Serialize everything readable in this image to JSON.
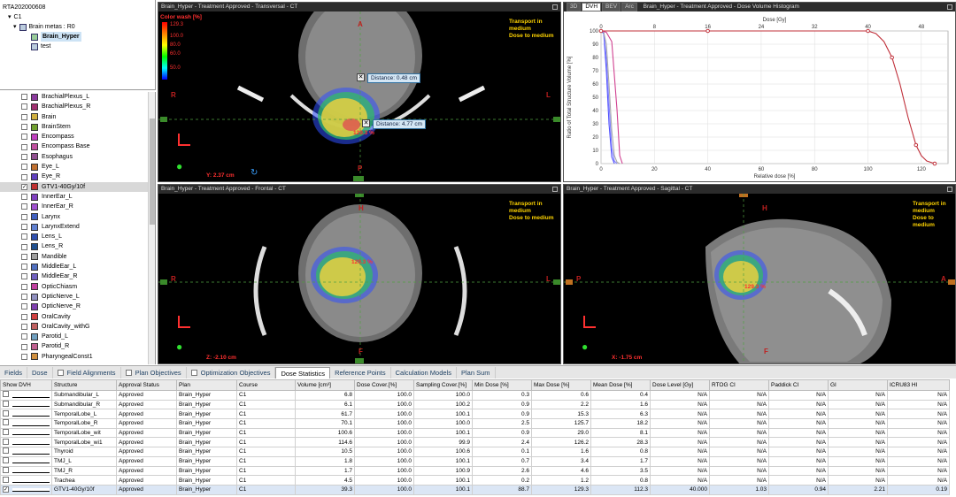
{
  "tree": {
    "root": "RTA202000608",
    "course": "C1",
    "metas": "Brain metas : R0",
    "plan": "Brain_Hyper",
    "test": "test"
  },
  "structures": [
    {
      "name": "BrachialPlexus_L",
      "color": "#8b3a9c",
      "checked": false
    },
    {
      "name": "BrachialPlexus_R",
      "color": "#a03070",
      "checked": false
    },
    {
      "name": "Brain",
      "color": "#d0b040",
      "checked": false
    },
    {
      "name": "BrainStem",
      "color": "#70a030",
      "checked": false
    },
    {
      "name": "Encompass",
      "color": "#c040c0",
      "checked": false
    },
    {
      "name": "Encompass Base",
      "color": "#c050a0",
      "checked": false
    },
    {
      "name": "Esophagus",
      "color": "#905090",
      "checked": false
    },
    {
      "name": "Eye_L",
      "color": "#c07030",
      "checked": false
    },
    {
      "name": "Eye_R",
      "color": "#6040c0",
      "checked": false
    },
    {
      "name": "GTV1-40Gy/10f",
      "color": "#c03030",
      "checked": true,
      "selected": true
    },
    {
      "name": "InnerEar_L",
      "color": "#8040c0",
      "checked": false
    },
    {
      "name": "InnerEar_R",
      "color": "#a050d0",
      "checked": false
    },
    {
      "name": "Larynx",
      "color": "#4060c0",
      "checked": false
    },
    {
      "name": "LarynxExtend",
      "color": "#6080d0",
      "checked": false
    },
    {
      "name": "Lens_L",
      "color": "#3050b0",
      "checked": false
    },
    {
      "name": "Lens_R",
      "color": "#205090",
      "checked": false
    },
    {
      "name": "Mandible",
      "color": "#a0a0a0",
      "checked": false
    },
    {
      "name": "MiddleEar_L",
      "color": "#5070c0",
      "checked": false
    },
    {
      "name": "MiddleEar_R",
      "color": "#7060c0",
      "checked": false
    },
    {
      "name": "OpticChiasm",
      "color": "#c040a0",
      "checked": false
    },
    {
      "name": "OpticNerve_L",
      "color": "#9090c0",
      "checked": false
    },
    {
      "name": "OpticNerve_R",
      "color": "#8040b0",
      "checked": false
    },
    {
      "name": "OralCavity",
      "color": "#d04040",
      "checked": false
    },
    {
      "name": "OralCavity_withG",
      "color": "#c06060",
      "checked": false
    },
    {
      "name": "Parotid_L",
      "color": "#70a0c0",
      "checked": false
    },
    {
      "name": "Parotid_R",
      "color": "#c06090",
      "checked": false
    },
    {
      "name": "PharyngealConst1",
      "color": "#d09040",
      "checked": false
    }
  ],
  "views": {
    "transversal": {
      "title": "Brain_Hyper - Treatment Approved - Transversal - CT",
      "coord": "Y: 2.37 cm",
      "legend_title": "Color wash [%]",
      "legend_max": "129.3",
      "legend_vals": [
        "100.0",
        "80.0",
        "60.0",
        "50.0"
      ],
      "dist1": "Distance: 0.48 cm",
      "dist2": "Distance: 4.77 cm",
      "hotspot": "129.3 %",
      "orient": {
        "top": "A",
        "left": "R",
        "right": "L",
        "bottom": "P"
      }
    },
    "frontal": {
      "title": "Brain_Hyper - Treatment Approved - Frontal - CT",
      "coord": "Z: -2.10 cm",
      "hotspot": "129.3 %",
      "orient": {
        "top": "H",
        "left": "R",
        "right": "L",
        "bottom": "F"
      }
    },
    "sagittal": {
      "title": "Brain_Hyper - Treatment Approved - Sagittal - CT",
      "coord": "X: -1.75 cm",
      "hotspot": "129.3 %",
      "orient": {
        "top": "H",
        "left": "P",
        "right": "A",
        "bottom": "F"
      }
    },
    "transport_line1": "Transport in",
    "transport_line2": "medium",
    "transport_line3": "Dose to medium"
  },
  "dvh": {
    "tabs": [
      "3D",
      "DVH",
      "BEV",
      "Arc"
    ],
    "active_tab": "DVH",
    "title": "Brain_Hyper - Treatment Approved - Dose Volume Histogram"
  },
  "chart_data": {
    "type": "line",
    "title": "Dose [Gy]",
    "xlabel": "Relative dose [%]",
    "ylabel": "Ratio of Total Structure Volume [%]",
    "xlim": [
      0,
      130
    ],
    "ylim": [
      0,
      100
    ],
    "x_ticks": [
      0,
      20,
      40,
      60,
      80,
      100,
      120
    ],
    "y_ticks": [
      0,
      10,
      20,
      30,
      40,
      50,
      60,
      70,
      80,
      90,
      100
    ],
    "top_ticks": [
      0,
      8,
      16,
      24,
      32,
      40,
      48
    ],
    "series": [
      {
        "color": "#c0303a",
        "x": [
          0,
          1,
          20,
          40,
          60,
          80,
          100,
          103,
          106,
          109,
          112,
          115,
          118,
          120,
          122,
          125
        ],
        "y": [
          100,
          100,
          100,
          100,
          100,
          100,
          100,
          98,
          92,
          80,
          60,
          35,
          14,
          6,
          2,
          0
        ]
      },
      {
        "color": "#5050ff",
        "x": [
          0,
          1,
          2,
          3,
          4,
          5
        ],
        "y": [
          100,
          98,
          70,
          30,
          5,
          0
        ]
      },
      {
        "color": "#8080ff",
        "x": [
          0,
          1,
          2,
          3,
          4,
          5,
          6
        ],
        "y": [
          100,
          99,
          80,
          45,
          12,
          2,
          0
        ]
      },
      {
        "color": "#ffffff",
        "x": [
          0,
          1,
          2,
          3,
          4,
          5,
          6,
          7
        ],
        "y": [
          100,
          99,
          90,
          60,
          25,
          6,
          1,
          0
        ]
      },
      {
        "color": "#d04090",
        "x": [
          0,
          2,
          4,
          6,
          7,
          8
        ],
        "y": [
          100,
          99,
          92,
          40,
          6,
          0
        ]
      }
    ]
  },
  "tabs": [
    {
      "label": "Fields",
      "cb": false
    },
    {
      "label": "Dose",
      "cb": false
    },
    {
      "label": "Field Alignments",
      "cb": true
    },
    {
      "label": "Plan Objectives",
      "cb": true
    },
    {
      "label": "Optimization Objectives",
      "cb": true
    },
    {
      "label": "Dose Statistics",
      "cb": false,
      "active": true
    },
    {
      "label": "Reference Points",
      "cb": false
    },
    {
      "label": "Calculation Models",
      "cb": false
    },
    {
      "label": "Plan Sum",
      "cb": false
    }
  ],
  "table": {
    "headers": [
      "Show DVH",
      "Structure",
      "Approval Status",
      "Plan",
      "Course",
      "Volume [cm³]",
      "Dose Cover.[%]",
      "Sampling Cover.[%]",
      "Min Dose [%]",
      "Max Dose [%]",
      "Mean Dose [%]",
      "Dose Level [Gy]",
      "RTOG CI",
      "Paddick CI",
      "GI",
      "ICRU83 HI"
    ],
    "rows": [
      [
        "Submandibular_L",
        "Approved",
        "Brain_Hyper",
        "C1",
        "6.8",
        "100.0",
        "100.0",
        "0.3",
        "0.6",
        "0.4",
        "N/A",
        "N/A",
        "N/A",
        "N/A",
        "N/A"
      ],
      [
        "Submandibular_R",
        "Approved",
        "Brain_Hyper",
        "C1",
        "6.1",
        "100.0",
        "100.2",
        "0.9",
        "2.2",
        "1.6",
        "N/A",
        "N/A",
        "N/A",
        "N/A",
        "N/A"
      ],
      [
        "TemporalLobe_L",
        "Approved",
        "Brain_Hyper",
        "C1",
        "61.7",
        "100.0",
        "100.1",
        "0.9",
        "15.3",
        "6.3",
        "N/A",
        "N/A",
        "N/A",
        "N/A",
        "N/A"
      ],
      [
        "TemporalLobe_R",
        "Approved",
        "Brain_Hyper",
        "C1",
        "70.1",
        "100.0",
        "100.0",
        "2.5",
        "125.7",
        "18.2",
        "N/A",
        "N/A",
        "N/A",
        "N/A",
        "N/A"
      ],
      [
        "TemporalLobe_wit",
        "Approved",
        "Brain_Hyper",
        "C1",
        "100.6",
        "100.0",
        "100.1",
        "0.9",
        "29.0",
        "8.1",
        "N/A",
        "N/A",
        "N/A",
        "N/A",
        "N/A"
      ],
      [
        "TemporalLobe_wi1",
        "Approved",
        "Brain_Hyper",
        "C1",
        "114.6",
        "100.0",
        "99.9",
        "2.4",
        "126.2",
        "28.3",
        "N/A",
        "N/A",
        "N/A",
        "N/A",
        "N/A"
      ],
      [
        "Thyroid",
        "Approved",
        "Brain_Hyper",
        "C1",
        "10.5",
        "100.0",
        "100.6",
        "0.1",
        "1.6",
        "0.8",
        "N/A",
        "N/A",
        "N/A",
        "N/A",
        "N/A"
      ],
      [
        "TMJ_L",
        "Approved",
        "Brain_Hyper",
        "C1",
        "1.8",
        "100.0",
        "100.1",
        "0.7",
        "3.4",
        "1.7",
        "N/A",
        "N/A",
        "N/A",
        "N/A",
        "N/A"
      ],
      [
        "TMJ_R",
        "Approved",
        "Brain_Hyper",
        "C1",
        "1.7",
        "100.0",
        "100.9",
        "2.6",
        "4.6",
        "3.5",
        "N/A",
        "N/A",
        "N/A",
        "N/A",
        "N/A"
      ],
      [
        "Trachea",
        "Approved",
        "Brain_Hyper",
        "C1",
        "4.5",
        "100.0",
        "100.1",
        "0.2",
        "1.2",
        "0.8",
        "N/A",
        "N/A",
        "N/A",
        "N/A",
        "N/A"
      ],
      [
        "GTV1-40Gy/10f",
        "Approved",
        "Brain_Hyper",
        "C1",
        "39.3",
        "100.0",
        "100.1",
        "88.7",
        "129.3",
        "112.3",
        "40.000",
        "1.03",
        "0.94",
        "2.21",
        "0.19"
      ]
    ],
    "checked_row": 10
  }
}
